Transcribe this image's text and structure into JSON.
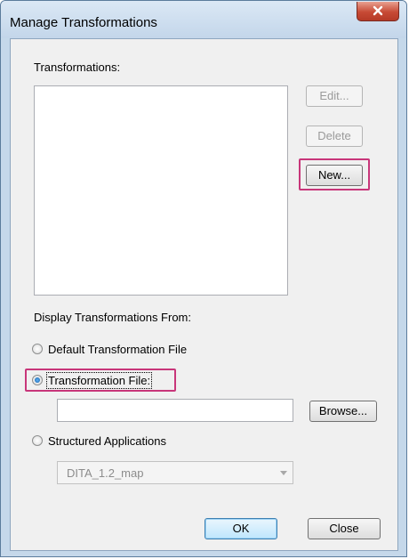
{
  "window": {
    "title": "Manage Transformations",
    "close_glyph": "✕"
  },
  "transformations": {
    "label": "Transformations:",
    "items": []
  },
  "buttons": {
    "edit": {
      "label": "Edit...",
      "enabled": false
    },
    "delete": {
      "label": "Delete",
      "enabled": false
    },
    "new": {
      "label": "New...",
      "enabled": true,
      "highlighted": true
    },
    "browse": {
      "label": "Browse...",
      "enabled": true
    },
    "ok": {
      "label": "OK",
      "default": true
    },
    "close": {
      "label": "Close"
    }
  },
  "display_from": {
    "label": "Display Transformations From:",
    "options": [
      {
        "label": "Default Transformation File",
        "selected": false
      },
      {
        "label": "Transformation File:",
        "selected": true,
        "highlighted": true
      },
      {
        "label": "Structured Applications",
        "selected": false
      }
    ],
    "transformation_file_path": "",
    "structured_application_selected": "DITA_1.2_map",
    "structured_application_enabled": false
  },
  "colors": {
    "highlight": "#c8367a",
    "dialog_bg": "#f0f0f0",
    "titlebar": "#c5d8ea",
    "close_button": "#c74a35"
  },
  "icons": {
    "close": "close-icon",
    "dropdown": "chevron-down-icon"
  }
}
